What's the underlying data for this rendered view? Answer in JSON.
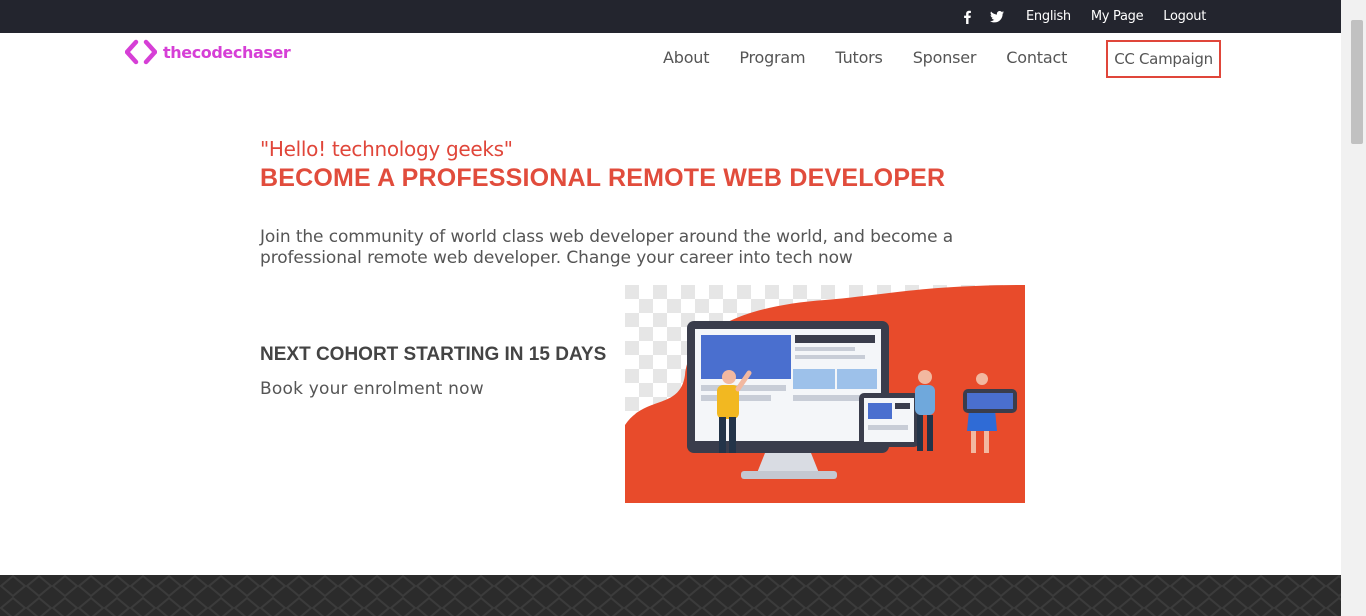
{
  "topbar": {
    "social": [
      {
        "icon": "facebook-icon"
      },
      {
        "icon": "twitter-icon"
      }
    ],
    "links": [
      "English",
      "My Page",
      "Logout"
    ]
  },
  "header": {
    "logo_text": "thecodechaser",
    "nav": [
      "About",
      "Program",
      "Tutors",
      "Sponser",
      "Contact"
    ],
    "cta": "CC Campaign"
  },
  "hero": {
    "greeting": "\"Hello! technology geeks\"",
    "headline": "BECOME A PROFESSIONAL REMOTE WEB DEVELOPER",
    "intro": "Join the community of world class web developer around the world, and become a professional remote web developer. Change your career into tech now",
    "cohort": "NEXT COHORT STARTING IN 15 DAYS",
    "book": "Book your enrolment now"
  },
  "colors": {
    "accent": "#e14c3c",
    "logo": "#d63fd6",
    "topbar": "#23252e"
  }
}
